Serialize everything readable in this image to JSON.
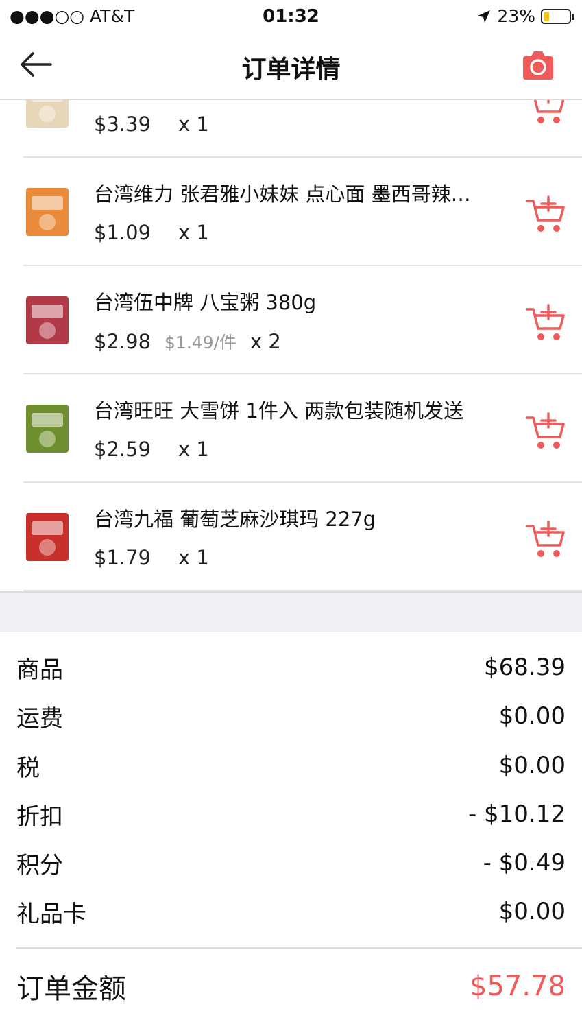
{
  "status_bar": {
    "carrier": "●●●○○ AT&T",
    "time": "01:32",
    "battery": "23%",
    "battery_level": 0.23,
    "battery_color": "#f5c41c"
  },
  "nav": {
    "back_icon": "arrow-left-icon",
    "title": "订单详情",
    "camera_icon": "camera-icon",
    "accent_color": "#ef5b5b"
  },
  "items": [
    {
      "name": "",
      "price": "$3.39",
      "unit_price": "",
      "qty": "x 1",
      "thumb_color": "#e8d6b8"
    },
    {
      "name": "台湾维力 张君雅小妹妹 点心面 墨西哥辣…",
      "price": "$1.09",
      "unit_price": "",
      "qty": "x 1",
      "thumb_color": "#e98b3a"
    },
    {
      "name": "台湾伍中牌 八宝粥 380g",
      "price": "$2.98",
      "unit_price": "$1.49/件",
      "qty": "x 2",
      "thumb_color": "#b23a48"
    },
    {
      "name": "台湾旺旺 大雪饼 1件入 两款包装随机发送",
      "price": "$2.59",
      "unit_price": "",
      "qty": "x 1",
      "thumb_color": "#6f8f2e"
    },
    {
      "name": "台湾九福 葡萄芝麻沙琪玛 227g",
      "price": "$1.79",
      "unit_price": "",
      "qty": "x 1",
      "thumb_color": "#c8302c"
    }
  ],
  "summary": {
    "rows": [
      {
        "label": "商品",
        "value": "$68.39"
      },
      {
        "label": "运费",
        "value": "$0.00"
      },
      {
        "label": "税",
        "value": "$0.00"
      },
      {
        "label": "折扣",
        "value": "- $10.12"
      },
      {
        "label": "积分",
        "value": "- $0.49"
      },
      {
        "label": "礼品卡",
        "value": "$0.00"
      }
    ],
    "total_label": "订单金额",
    "total_value": "$57.78"
  }
}
